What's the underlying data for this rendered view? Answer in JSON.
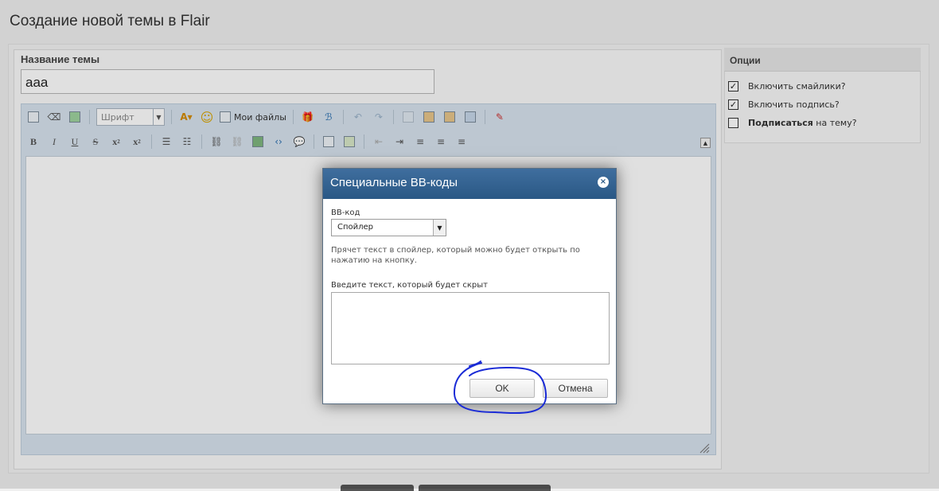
{
  "page": {
    "title": "Создание новой темы в Flair"
  },
  "form": {
    "topic_label": "Название темы",
    "topic_value": "ааа"
  },
  "toolbar": {
    "font_placeholder": "Шрифт",
    "my_files": "Мои файлы",
    "format_bold": "B",
    "format_italic": "I",
    "format_underline": "U",
    "format_strike": "S",
    "format_sub": "x",
    "format_sup": "x"
  },
  "options": {
    "title": "Опции",
    "items": [
      {
        "label": "Включить смайлики?",
        "checked": true
      },
      {
        "label": "Включить подпись?",
        "checked": true
      },
      {
        "label_bold": "Подписаться",
        "label_rest": " на тему?",
        "checked": false
      }
    ]
  },
  "dialog": {
    "title": "Специальные BB-коды",
    "bbcode_label": "BB-код",
    "bbcode_value": "Спойлер",
    "hint": "Прячет текст в спойлер, который можно будет открыть по нажатию на кнопку.",
    "text_label": "Введите текст, который будет скрыт",
    "ok": "OK",
    "cancel": "Отмена"
  },
  "colors": {
    "dialog_header": "#2a5885",
    "annotation": "#1a2bd6"
  }
}
